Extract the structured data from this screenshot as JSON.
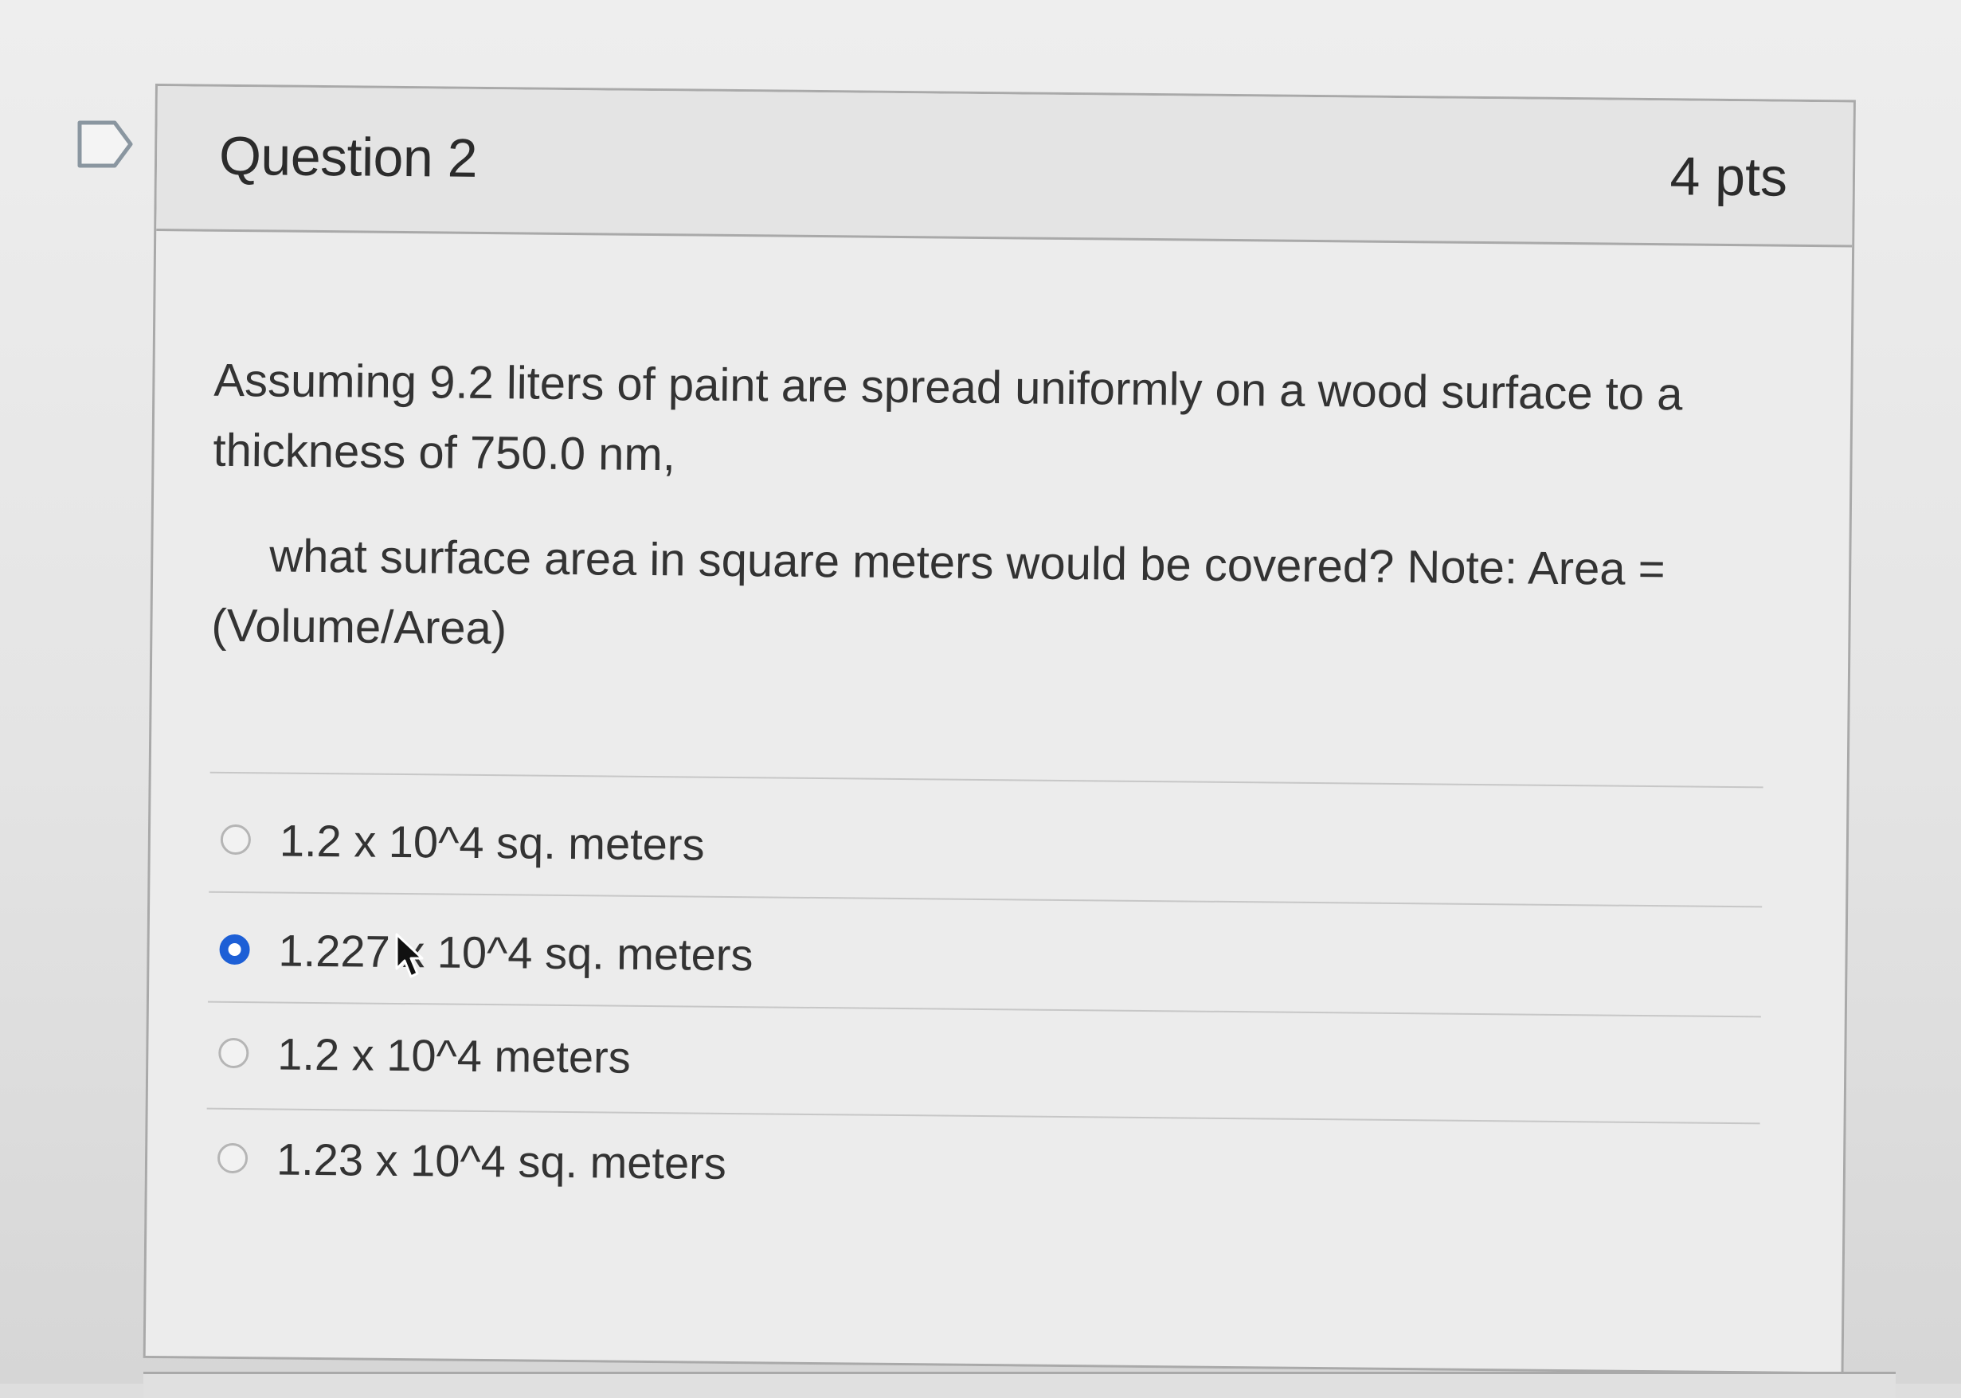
{
  "question": {
    "title": "Question 2",
    "points": "4 pts",
    "text_line_1": "Assuming 9.2 liters of paint are spread uniformly on a wood surface to a thickness of 750.0 nm,",
    "text_line_2": "what surface area in square meters would be covered?  Note:  Area =(Volume/Area)"
  },
  "answers": [
    {
      "label": "1.2 x 10^4 sq. meters",
      "selected": false
    },
    {
      "label": "1.227 x 10^4 sq. meters",
      "selected": true
    },
    {
      "label": "1.2 x 10^4 meters",
      "selected": false
    },
    {
      "label": "1.23 x 10^4 sq. meters",
      "selected": false
    }
  ],
  "icons": {
    "flag": "flag-icon",
    "cursor": "mouse-pointer-icon"
  },
  "colors": {
    "selected_radio": "#1d5fd6",
    "border": "#a9a9a9",
    "header_bg": "#e4e4e4"
  }
}
